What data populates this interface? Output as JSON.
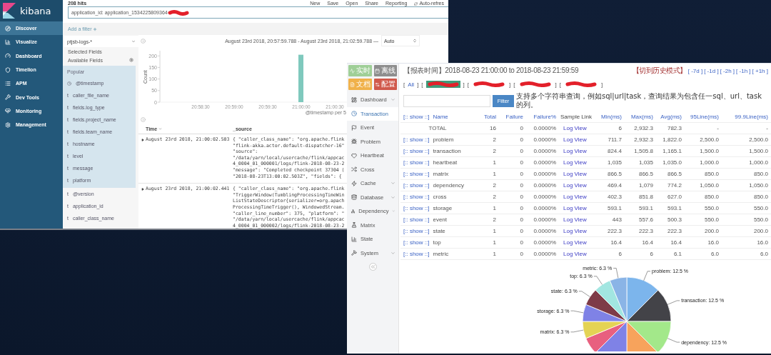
{
  "kibana": {
    "logo": "kibana",
    "nav": [
      {
        "label": "Discover",
        "selected": true
      },
      {
        "label": "Visualize",
        "selected": false
      },
      {
        "label": "Dashboard",
        "selected": false
      },
      {
        "label": "Timelion",
        "selected": false
      },
      {
        "label": "APM",
        "selected": false
      },
      {
        "label": "Dev Tools",
        "selected": false
      },
      {
        "label": "Monitoring",
        "selected": false
      },
      {
        "label": "Management",
        "selected": false
      }
    ],
    "hits": "208 hits",
    "top_menu": [
      {
        "kind": "plain",
        "label": "New"
      },
      {
        "kind": "plain",
        "label": "Save"
      },
      {
        "kind": "plain",
        "label": "Open"
      },
      {
        "kind": "plain",
        "label": "Share"
      },
      {
        "kind": "plain",
        "label": "Reporting"
      },
      {
        "kind": "refresh",
        "label": "Auto-refres"
      }
    ],
    "query": {
      "value": "application_id: application_1534225809364",
      "redacted": true
    },
    "add_filter": "Add a filter",
    "index_pattern": "ptjsb-logs-*",
    "selected_fields": "Selected Fields",
    "available_fields": "Available Fields",
    "popular_label": "Popular",
    "fields": [
      {
        "kind": "date",
        "name": "@timestamp",
        "popular": true
      },
      {
        "kind": "string",
        "type_label": "t",
        "name": "caller_file_name",
        "popular": true
      },
      {
        "kind": "string",
        "type_label": "t",
        "name": "fields.log_type",
        "popular": true
      },
      {
        "kind": "string",
        "type_label": "t",
        "name": "fields.project_name",
        "popular": true
      },
      {
        "kind": "string",
        "type_label": "t",
        "name": "fields.team_name",
        "popular": true
      },
      {
        "kind": "string",
        "type_label": "t",
        "name": "hostname",
        "popular": true
      },
      {
        "kind": "string",
        "type_label": "t",
        "name": "level",
        "popular": true
      },
      {
        "kind": "string",
        "type_label": "t",
        "name": "message",
        "popular": true
      },
      {
        "kind": "string",
        "type_label": "t",
        "name": "platform",
        "popular": true
      },
      {
        "kind": "string",
        "type_label": "t",
        "name": "@version",
        "popular": false
      },
      {
        "kind": "string",
        "type_label": "t",
        "name": "application_id",
        "popular": false
      },
      {
        "kind": "string",
        "type_label": "t",
        "name": "caller_class_name",
        "popular": false
      }
    ],
    "time_range": "August 23rd 2018, 20:57:59.788 - August 23rd 2018, 21:02:59.788 —",
    "interval": "Auto",
    "chart_data": {
      "type": "bar",
      "ylabel": "Count",
      "xlabel": "@timestamp per 5",
      "categories": [
        "20:58:30",
        "20:59:00",
        "20:59:30",
        "21:00:00",
        "21:00:30"
      ],
      "series": [
        {
          "color": "#7fc9bd",
          "values": [
            null,
            null,
            null,
            205,
            null
          ]
        }
      ],
      "ylim": [
        0,
        210
      ],
      "yticks": [
        0,
        50,
        100,
        150,
        200
      ]
    },
    "table": {
      "columns": [
        "Time",
        "_source"
      ],
      "rows": [
        {
          "time": "August 23rd 2018, 21:00:02.503",
          "source": [
            "{ \"caller_class_name\": \"org.apache.flink",
            "\"flink-akka.actor.default-dispatcher-16\"",
            "\"source\":",
            "\"/data/yarn/local/usercache/flink/appcac",
            "4_0004_01_000001/logs/flink-2018-08-23-2",
            "\"message\": \"Completed checkpoint 37304 (",
            "\"2018-08-23T13:00:02.503Z\", \"fields\": {"
          ]
        },
        {
          "time": "August 23rd 2018, 21:00:02.441",
          "source": [
            "{ \"caller_class_name\": \"org.apache.flink",
            "\"TriggerWindow(TumblingProcessingTimeWin",
            "ListStateDescriptor{serializer=org.apach",
            "ProcessingTimeTrigger(), WindowedStream.",
            "\"caller_line_number\": 375, \"platform\": \"",
            "\"/data/yarn/local/usercache/flink/appcac",
            "4_0004_01_000002/logs/flink-2018-08-23-2"
          ]
        }
      ]
    }
  },
  "cat": {
    "mode_buttons": [
      {
        "label": "实时",
        "color": "#9fcf97"
      },
      {
        "label": "离线",
        "color": "#8e8e8e"
      },
      {
        "label": "文档",
        "color": "#f0b14a"
      },
      {
        "label": "配置",
        "color": "#d0584b"
      }
    ],
    "nav": [
      {
        "label": "Dashboard",
        "expandable": true,
        "selected": false
      },
      {
        "label": "Transaction",
        "expandable": false,
        "selected": true
      },
      {
        "label": "Event",
        "expandable": false,
        "selected": false
      },
      {
        "label": "Problem",
        "expandable": false,
        "selected": false
      },
      {
        "label": "Heartbeat",
        "expandable": false,
        "selected": false
      },
      {
        "label": "Cross",
        "expandable": false,
        "selected": false
      },
      {
        "label": "Cache",
        "expandable": true,
        "selected": false
      },
      {
        "label": "Database",
        "expandable": true,
        "selected": false
      },
      {
        "label": "Dependency",
        "expandable": true,
        "selected": false
      },
      {
        "label": "Matrix",
        "expandable": false,
        "selected": false
      },
      {
        "label": "State",
        "expandable": false,
        "selected": false
      },
      {
        "label": "System",
        "expandable": true,
        "selected": false
      }
    ],
    "report_time": "【报表时间】2018-08-23 21:00:00 to 2018-08-23 21:59:59",
    "history_mode": "【切到历史模式】",
    "time_steps": [
      "[ -7d ]",
      "[ -1d ]",
      "[ -2h ]",
      "[ -1h ]",
      "[ +1h ]"
    ],
    "domain_bar": {
      "open": "[",
      "close": "]",
      "items": [
        {
          "kind": "text",
          "label": "All",
          "selected": false
        },
        {
          "kind": "redacted",
          "selected": true
        },
        {
          "kind": "redacted",
          "selected": false
        },
        {
          "kind": "redacted",
          "selected": false
        },
        {
          "kind": "redacted",
          "selected": false
        }
      ]
    },
    "filter": {
      "button": "Filter",
      "hint": "支持多个字符串查询，例如sql|url|task，查询结果为包含任一sql、url、task的列。"
    },
    "table": {
      "columns": [
        {
          "label": "Name",
          "show": "[:: show ::]",
          "sortable": true
        },
        {
          "label": "Total",
          "sortable": true
        },
        {
          "label": "Failure",
          "sortable": true
        },
        {
          "label": "Failure%",
          "sortable": true
        },
        {
          "label": "Sample Link",
          "sortable": false
        },
        {
          "label": "Min(ms)",
          "sortable": true
        },
        {
          "label": "Max(ms)",
          "sortable": true
        },
        {
          "label": "Avg(ms)",
          "sortable": true
        },
        {
          "label": "95Line(ms)",
          "sortable": true
        },
        {
          "label": "99.9Line(ms)",
          "sortable": true
        }
      ],
      "rows": [
        {
          "kind": "total",
          "name": "TOTAL",
          "total": "16",
          "failure": "0",
          "failure_pct": "0.0000%",
          "link": "Log View",
          "min": "6",
          "max": "2,932.3",
          "avg": "782.3",
          "p95": "-",
          "p999": "-"
        },
        {
          "kind": "item",
          "show": "[:: show ::]",
          "name": "problem",
          "total": "2",
          "failure": "0",
          "failure_pct": "0.0000%",
          "link": "Log View",
          "min": "711.7",
          "max": "2,932.3",
          "avg": "1,822.0",
          "p95": "2,500.0",
          "p999": "2,500.0"
        },
        {
          "kind": "item",
          "show": "[:: show ::]",
          "name": "transaction",
          "total": "2",
          "failure": "0",
          "failure_pct": "0.0000%",
          "link": "Log View",
          "min": "824.4",
          "max": "1,505.8",
          "avg": "1,165.1",
          "p95": "1,500.0",
          "p999": "1,500.0"
        },
        {
          "kind": "item",
          "show": "[:: show ::]",
          "name": "heartbeat",
          "total": "1",
          "failure": "0",
          "failure_pct": "0.0000%",
          "link": "Log View",
          "min": "1,035",
          "max": "1,035",
          "avg": "1,035.0",
          "p95": "1,000.0",
          "p999": "1,000.0"
        },
        {
          "kind": "item",
          "show": "[:: show ::]",
          "name": "matrix",
          "total": "1",
          "failure": "0",
          "failure_pct": "0.0000%",
          "link": "Log View",
          "min": "866.5",
          "max": "866.5",
          "avg": "866.5",
          "p95": "850.0",
          "p999": "850.0"
        },
        {
          "kind": "item",
          "show": "[:: show ::]",
          "name": "dependency",
          "total": "2",
          "failure": "0",
          "failure_pct": "0.0000%",
          "link": "Log View",
          "min": "469.4",
          "max": "1,079",
          "avg": "774.2",
          "p95": "1,050.0",
          "p999": "1,050.0"
        },
        {
          "kind": "item",
          "show": "[:: show ::]",
          "name": "cross",
          "total": "2",
          "failure": "0",
          "failure_pct": "0.0000%",
          "link": "Log View",
          "min": "402.3",
          "max": "851.8",
          "avg": "627.0",
          "p95": "850.0",
          "p999": "850.0"
        },
        {
          "kind": "item",
          "show": "[:: show ::]",
          "name": "storage",
          "total": "1",
          "failure": "0",
          "failure_pct": "0.0000%",
          "link": "Log View",
          "min": "593.1",
          "max": "593.1",
          "avg": "593.1",
          "p95": "550.0",
          "p999": "550.0"
        },
        {
          "kind": "item",
          "show": "[:: show ::]",
          "name": "event",
          "total": "2",
          "failure": "0",
          "failure_pct": "0.0000%",
          "link": "Log View",
          "min": "443",
          "max": "557.6",
          "avg": "500.3",
          "p95": "550.0",
          "p999": "550.0"
        },
        {
          "kind": "item",
          "show": "[:: show ::]",
          "name": "state",
          "total": "1",
          "failure": "0",
          "failure_pct": "0.0000%",
          "link": "Log View",
          "min": "222.3",
          "max": "222.3",
          "avg": "222.3",
          "p95": "200.0",
          "p999": "200.0"
        },
        {
          "kind": "item",
          "show": "[:: show ::]",
          "name": "top",
          "total": "1",
          "failure": "0",
          "failure_pct": "0.0000%",
          "link": "Log View",
          "min": "16.4",
          "max": "16.4",
          "avg": "16.4",
          "p95": "16.0",
          "p999": "16.0"
        },
        {
          "kind": "item",
          "show": "[:: show ::]",
          "name": "metric",
          "total": "1",
          "failure": "0",
          "failure_pct": "0.0000%",
          "link": "Log View",
          "min": "6",
          "max": "6",
          "avg": "6.1",
          "p95": "6.0",
          "p999": "6.0"
        }
      ]
    },
    "chart_data": {
      "type": "pie",
      "categories": [
        "problem",
        "transaction",
        "dependency",
        null,
        null,
        null,
        "matrix",
        "storage",
        "state",
        "top",
        "metric"
      ],
      "series": [
        {
          "values": [
            12.5,
            12.5,
            12.5,
            12.5,
            12.5,
            6.25,
            6.25,
            6.25,
            6.25,
            6.25,
            6.25
          ]
        }
      ],
      "colors": [
        "#7cb5ec",
        "#434348",
        "#a3e88a",
        "#f7a35c",
        "#7f82e6",
        "#e8607f",
        "#e4d354",
        "#7f82e6",
        "#7e3b47",
        "#a2e6e1",
        "#8ab4e6"
      ],
      "value_labels": [
        ": 12.5 %",
        ": 12.5 %",
        ": 12.5 %",
        null,
        null,
        null,
        ": 6.3 %",
        ": 6.3 %",
        ": 6.3 %",
        ": 6.3 %",
        ": 6.3 %"
      ]
    }
  }
}
